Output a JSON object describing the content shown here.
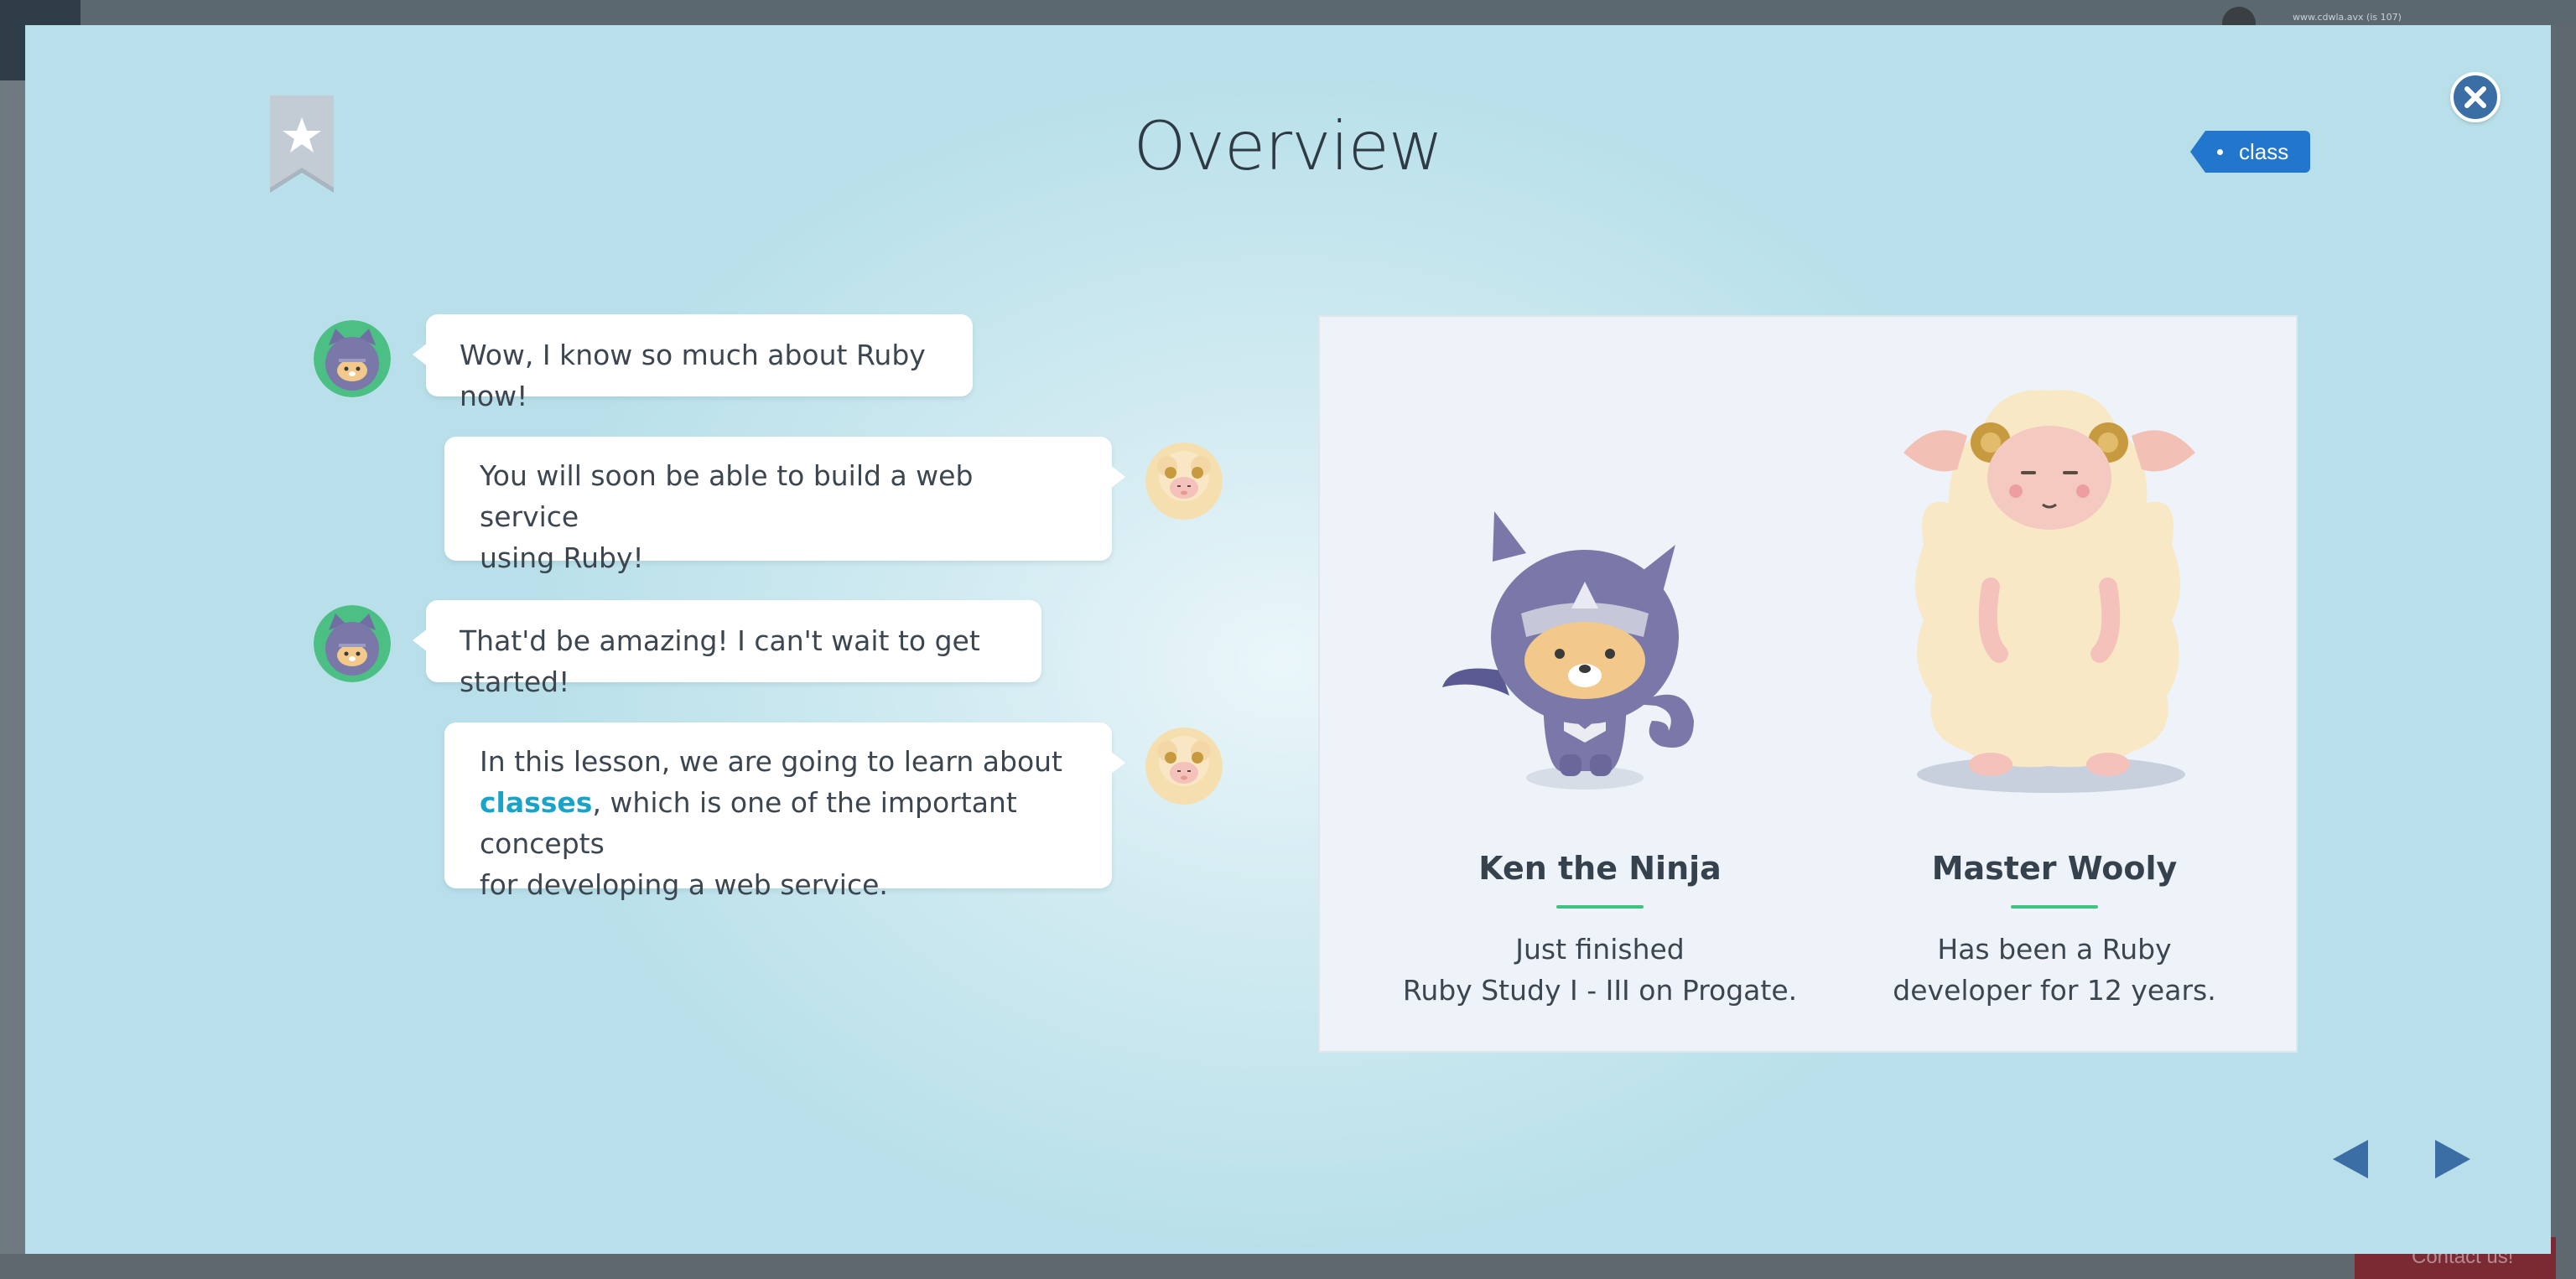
{
  "backdrop": {
    "url_text": "www.cdwla.avx (is 107)",
    "contact_label": "Contact us!"
  },
  "modal": {
    "title": "Overview",
    "tag_label": "class",
    "close_icon": "close-icon",
    "bookmark_icon": "bookmark-star-icon"
  },
  "chat": {
    "messages": [
      {
        "speaker": "ken",
        "side": "left",
        "text": "Wow, I know so much about Ruby now!"
      },
      {
        "speaker": "wooly",
        "side": "right",
        "text_lines": [
          "You will soon be able to build a web service",
          "using Ruby!"
        ]
      },
      {
        "speaker": "ken",
        "side": "left",
        "text": "That'd be amazing! I can't wait to get started!"
      },
      {
        "speaker": "wooly",
        "side": "right",
        "line1": "In this lesson, we are going to learn about",
        "highlight": "classes",
        "line2_rest": ", which is one of the important concepts",
        "line3": "for developing a web service."
      }
    ]
  },
  "characters": [
    {
      "name": "Ken the Ninja",
      "desc_lines": [
        "Just finished",
        "Ruby Study I - III on Progate."
      ]
    },
    {
      "name": "Master Wooly",
      "desc_lines": [
        "Has been a Ruby",
        "developer for 12 years."
      ]
    }
  ],
  "colors": {
    "accent_blue": "#2277cc",
    "close_blue": "#3b6ea5",
    "highlight": "#1aa3c8",
    "underline_green": "#3dc47e",
    "ninja_purple": "#7a78a8"
  },
  "navigation": {
    "prev_icon": "triangle-left-icon",
    "next_icon": "triangle-right-icon"
  }
}
